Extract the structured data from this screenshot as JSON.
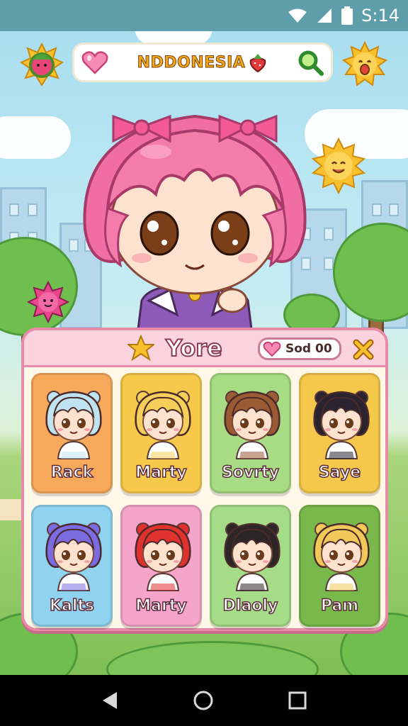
{
  "status_bar": {
    "time": "S:14",
    "icons": [
      "wifi-icon",
      "signal-icon",
      "battery-icon"
    ]
  },
  "top_bar": {
    "title": "NDDONESIA",
    "icons": [
      "heart-icon",
      "strawberry-icon",
      "search-icon"
    ]
  },
  "corner_icons": {
    "left": "watermelon-sun-icon",
    "right": "sun-face-icon"
  },
  "panel": {
    "title": "Yore",
    "currency_label": "Sod 00",
    "close_icon": "close-icon"
  },
  "characters": [
    {
      "name": "Rack",
      "card_color": "#f7a95b",
      "hair": "#bfe3f0"
    },
    {
      "name": "Marty",
      "card_color": "#f7c94a",
      "hair": "#f5cf5a"
    },
    {
      "name": "Sovrty",
      "card_color": "#a7dc84",
      "hair": "#9c5a34"
    },
    {
      "name": "Saye",
      "card_color": "#f5c84c",
      "hair": "#2a2430"
    },
    {
      "name": "Kalts",
      "card_color": "#8fd3f0",
      "hair": "#7a6be0"
    },
    {
      "name": "Marty",
      "card_color": "#f4a5c9",
      "hair": "#e0312e"
    },
    {
      "name": "Dlaoly",
      "card_color": "#a5dc88",
      "hair": "#2d2629"
    },
    {
      "name": "Pam",
      "card_color": "#79b84a",
      "hair": "#f3c85a"
    }
  ],
  "nav_bar": {
    "buttons": [
      "back-icon",
      "home-icon",
      "recents-icon"
    ]
  }
}
